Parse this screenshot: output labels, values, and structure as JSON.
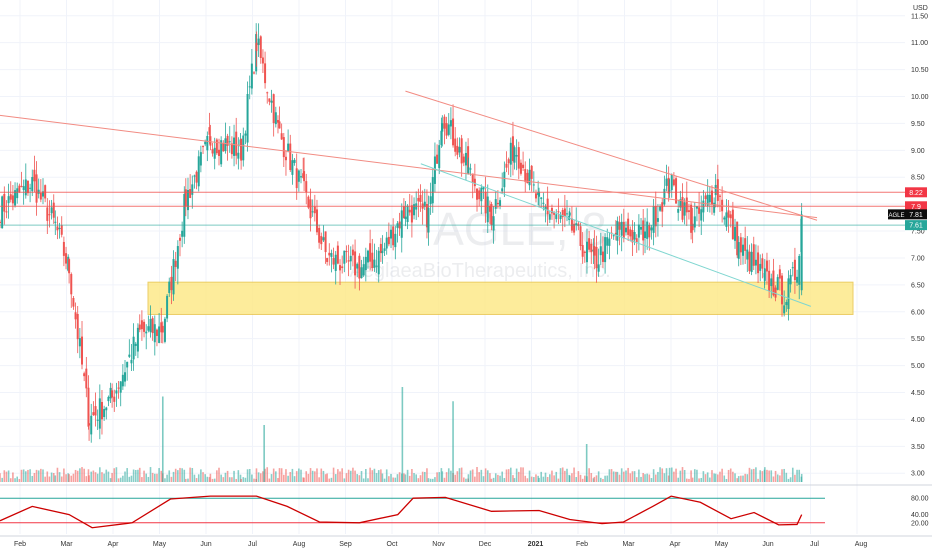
{
  "header": {
    "currency": "USD"
  },
  "watermark": {
    "symbol_text": "AGLE, 8",
    "company_text": "AeglaeaBioTherapeutics, Inc."
  },
  "price_axis": {
    "ticks": [
      "11.50",
      "11.00",
      "10.50",
      "10.00",
      "9.50",
      "9.00",
      "8.50",
      "8.00",
      "7.50",
      "7.00",
      "6.50",
      "6.00",
      "5.50",
      "5.00",
      "4.50",
      "4.00",
      "3.50",
      "3.00"
    ],
    "badges": [
      {
        "text": "8.22",
        "value": 8.22,
        "color": "#f23645"
      },
      {
        "text": "7.9",
        "value": 7.96,
        "color": "#f23645"
      },
      {
        "text": "7.81",
        "value": 7.81,
        "color": "#0d0d0d",
        "label": "AGLE"
      },
      {
        "text": "7.61",
        "value": 7.61,
        "color": "#26a69a"
      }
    ]
  },
  "rsi_axis": {
    "ticks": [
      "80.00",
      "40.00",
      "20.00"
    ]
  },
  "time_axis": {
    "labels": [
      "Feb",
      "Mar",
      "Apr",
      "May",
      "Jun",
      "Jul",
      "Aug",
      "Sep",
      "Oct",
      "Nov",
      "Dec",
      "2021",
      "Feb",
      "Mar",
      "Apr",
      "May",
      "Jun",
      "Jul",
      "Aug"
    ]
  },
  "colors": {
    "up": "#26a69a",
    "down": "#ef5350",
    "support_zone": "#fde98a",
    "trendline": "#f28b82",
    "support_line": "#7fd6d0",
    "rsi_line": "#cc0000",
    "rsi_upper": "#26a69a",
    "rsi_lower": "#f23645"
  },
  "chart_data": {
    "type": "candlestick",
    "ticker": "AGLE",
    "currency": "USD",
    "ylim": [
      2.8,
      11.7
    ],
    "last_price": 7.81,
    "support_zone": [
      5.95,
      6.55
    ],
    "horizontal_levels": [
      8.22,
      7.96,
      7.61
    ],
    "trendlines": [
      {
        "from": [
          "2020-01-20",
          9.65
        ],
        "to": [
          "2021-07-05",
          7.75
        ]
      },
      {
        "from": [
          "2020-10-10",
          10.1
        ],
        "to": [
          "2021-07-05",
          7.7
        ]
      },
      {
        "from": [
          "2020-10-20",
          8.75
        ],
        "to": [
          "2021-07-01",
          6.1
        ]
      }
    ],
    "anchor_points": [
      {
        "date": "2020-01-20",
        "close": 7.9
      },
      {
        "date": "2020-02-10",
        "close": 8.4
      },
      {
        "date": "2020-02-25",
        "close": 7.6
      },
      {
        "date": "2020-03-05",
        "close": 6.8
      },
      {
        "date": "2020-03-18",
        "close": 4.0
      },
      {
        "date": "2020-04-02",
        "close": 4.4
      },
      {
        "date": "2020-04-20",
        "close": 5.6
      },
      {
        "date": "2020-05-05",
        "close": 5.7
      },
      {
        "date": "2020-05-20",
        "close": 8.1
      },
      {
        "date": "2020-06-05",
        "close": 9.2
      },
      {
        "date": "2020-06-25",
        "close": 9.0
      },
      {
        "date": "2020-07-05",
        "close": 11.0
      },
      {
        "date": "2020-07-20",
        "close": 9.3
      },
      {
        "date": "2020-08-05",
        "close": 8.2
      },
      {
        "date": "2020-08-20",
        "close": 7.0
      },
      {
        "date": "2020-09-10",
        "close": 6.8
      },
      {
        "date": "2020-09-25",
        "close": 7.1
      },
      {
        "date": "2020-10-10",
        "close": 7.9
      },
      {
        "date": "2020-10-25",
        "close": 7.8
      },
      {
        "date": "2020-11-03",
        "close": 9.7
      },
      {
        "date": "2020-11-20",
        "close": 8.6
      },
      {
        "date": "2020-12-05",
        "close": 7.8
      },
      {
        "date": "2020-12-20",
        "close": 9.1
      },
      {
        "date": "2021-01-05",
        "close": 8.0
      },
      {
        "date": "2021-01-25",
        "close": 7.6
      },
      {
        "date": "2021-02-10",
        "close": 6.9
      },
      {
        "date": "2021-02-25",
        "close": 7.5
      },
      {
        "date": "2021-03-15",
        "close": 7.4
      },
      {
        "date": "2021-03-31",
        "close": 8.4
      },
      {
        "date": "2021-04-15",
        "close": 7.6
      },
      {
        "date": "2021-04-30",
        "close": 8.3
      },
      {
        "date": "2021-05-15",
        "close": 7.2
      },
      {
        "date": "2021-06-01",
        "close": 6.6
      },
      {
        "date": "2021-06-15",
        "close": 6.3
      },
      {
        "date": "2021-06-22",
        "close": 6.8
      },
      {
        "date": "2021-06-25",
        "close": 7.81
      }
    ],
    "volume_spikes": [
      {
        "date": "2020-05-05",
        "relative": 0.9
      },
      {
        "date": "2020-07-10",
        "relative": 0.6
      },
      {
        "date": "2020-10-08",
        "relative": 1.0
      },
      {
        "date": "2020-11-10",
        "relative": 0.85
      },
      {
        "date": "2021-02-05",
        "relative": 0.4
      }
    ],
    "rsi": {
      "upper": 80,
      "lower": 20,
      "last": 40,
      "points": [
        {
          "date": "2020-01-20",
          "value": 25
        },
        {
          "date": "2020-02-10",
          "value": 60
        },
        {
          "date": "2020-03-05",
          "value": 40
        },
        {
          "date": "2020-03-20",
          "value": 8
        },
        {
          "date": "2020-04-15",
          "value": 20
        },
        {
          "date": "2020-05-10",
          "value": 78
        },
        {
          "date": "2020-06-05",
          "value": 85
        },
        {
          "date": "2020-07-05",
          "value": 85
        },
        {
          "date": "2020-07-25",
          "value": 60
        },
        {
          "date": "2020-08-15",
          "value": 22
        },
        {
          "date": "2020-09-10",
          "value": 20
        },
        {
          "date": "2020-10-05",
          "value": 40
        },
        {
          "date": "2020-10-15",
          "value": 80
        },
        {
          "date": "2020-11-05",
          "value": 82
        },
        {
          "date": "2020-12-05",
          "value": 48
        },
        {
          "date": "2021-01-05",
          "value": 50
        },
        {
          "date": "2021-01-25",
          "value": 28
        },
        {
          "date": "2021-02-15",
          "value": 18
        },
        {
          "date": "2021-03-01",
          "value": 22
        },
        {
          "date": "2021-03-20",
          "value": 60
        },
        {
          "date": "2021-04-01",
          "value": 85
        },
        {
          "date": "2021-04-20",
          "value": 70
        },
        {
          "date": "2021-05-10",
          "value": 30
        },
        {
          "date": "2021-05-25",
          "value": 45
        },
        {
          "date": "2021-06-10",
          "value": 15
        },
        {
          "date": "2021-06-22",
          "value": 16
        },
        {
          "date": "2021-06-25",
          "value": 40
        }
      ]
    }
  }
}
